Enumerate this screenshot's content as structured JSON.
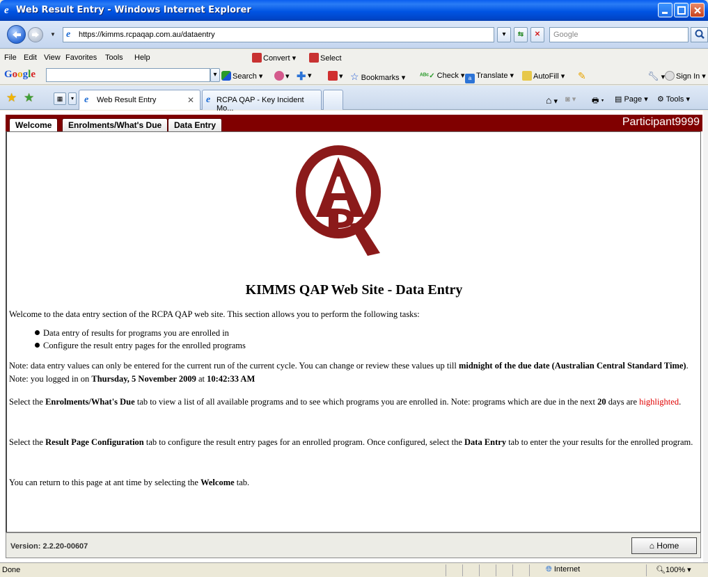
{
  "window": {
    "title": "Web Result Entry - Windows Internet Explorer"
  },
  "address_bar": {
    "url": "https://kimms.rcpaqap.com.au/dataentry",
    "search_placeholder": "Google"
  },
  "menu": [
    "File",
    "Edit",
    "View",
    "Favorites",
    "Tools",
    "Help"
  ],
  "toolbar": {
    "convert_label": "Convert",
    "select_label": "Select",
    "google_logo": "Google",
    "search_label": "Search",
    "bookmarks_label": "Bookmarks",
    "check_label": "Check",
    "translate_label": "Translate",
    "autofill_label": "AutoFill",
    "sign_in_label": "Sign In"
  },
  "browser_tabs": [
    {
      "label": "Web Result Entry",
      "active": true
    },
    {
      "label": "RCPA QAP - Key Incident Mo...",
      "active": false
    }
  ],
  "command_bar": {
    "page_label": "Page",
    "tools_label": "Tools"
  },
  "app_tabs": [
    "Welcome",
    "Enrolments/What's Due",
    "Data Entry"
  ],
  "participant": "Participant9999",
  "content": {
    "heading": "KIMMS QAP Web Site - Data Entry",
    "intro": "Welcome to the data entry section of the RCPA QAP web site. This section allows you to perform the following tasks:",
    "bullets": [
      "Data entry of results for programs you are enrolled in",
      "Configure the result entry pages for the enrolled programs"
    ],
    "note_a": "Note: data entry values can only be entered for the current run of the current cycle. You can change or review these values up till ",
    "note_b_bold": "midnight of the due date (Australian Central Standard Time)",
    "note_c": ". Note: you logged in on ",
    "note_d_bold": "Thursday, 5 November 2009",
    "note_e": " at ",
    "note_f_bold": "10:42:33 AM",
    "enrol_a": "Select the ",
    "enrol_b_bold": "Enrolments/What's Due",
    "enrol_c": " tab to view a list of all available programs and to see which programs you are enrolled in. Note: programs which are due in the next ",
    "enrol_d_bold": "20",
    "enrol_e": " days are ",
    "enrol_f_red": "highlighted",
    "enrol_g": ".",
    "config_a": "Select the ",
    "config_b_bold": "Result Page Configuration",
    "config_c": " tab to configure the result entry pages for an enrolled program. Once configured, select the ",
    "config_d_bold": "Data Entry",
    "config_e": " tab to enter the your results for the enrolled program.",
    "return_a": "You can return to this page at ant time by selecting the ",
    "return_b_bold": "Welcome",
    "return_c": " tab."
  },
  "footer": {
    "version": "Version: 2.2.20-00607",
    "home_label": "Home"
  },
  "status_bar": {
    "status": "Done",
    "zone": "Internet",
    "zoom": "100%"
  },
  "colors": {
    "app_tab_bar": "#800000",
    "logo": "#8b1a1a",
    "highlight": "#e00000"
  }
}
